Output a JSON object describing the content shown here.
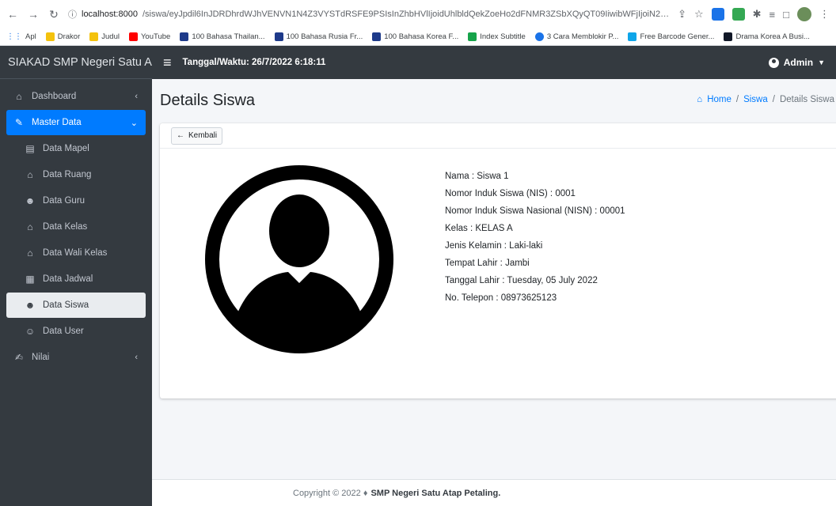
{
  "browser": {
    "url_host": "localhost:8000",
    "url_path": "/siswa/eyJpdil6InJDRDhrdWJhVENVN1N4Z3VYSTdRSFE9PSIsInZhbHVlIjoidUhlbldQekZoeHo2dFNMR3ZSbXQyQT09IiwibWFjIjoiN2M2NjcwNmI5Z...",
    "bookmarks": [
      "Apl",
      "Drakor",
      "Judul",
      "YouTube",
      "100 Bahasa Thailan...",
      "100 Bahasa Rusia Fr...",
      "100 Bahasa Korea F...",
      "Index Subtitle",
      "3 Cara Memblokir P...",
      "Free Barcode Gener...",
      "Drama Korea A Busi..."
    ]
  },
  "app": {
    "brand": "SIAKAD SMP Negeri Satu Atap",
    "datetime": "Tanggal/Waktu: 26/7/2022 6:18:11",
    "user": "Admin"
  },
  "sidebar": {
    "items": [
      {
        "label": "Dashboard"
      },
      {
        "label": "Master Data"
      },
      {
        "label": "Data Mapel"
      },
      {
        "label": "Data Ruang"
      },
      {
        "label": "Data Guru"
      },
      {
        "label": "Data Kelas"
      },
      {
        "label": "Data Wali Kelas"
      },
      {
        "label": "Data Jadwal"
      },
      {
        "label": "Data Siswa"
      },
      {
        "label": "Data User"
      },
      {
        "label": "Nilai"
      }
    ]
  },
  "page": {
    "title": "Details Siswa",
    "breadcrumb": [
      "Home",
      "Siswa",
      "Details Siswa"
    ],
    "back_label": "Kembali"
  },
  "student": {
    "nama": "Nama : Siswa 1",
    "nis": "Nomor Induk Siswa (NIS) : 0001",
    "nisn": "Nomor Induk Siswa Nasional (NISN) : 00001",
    "kelas": "Kelas : KELAS A",
    "jenis_kelamin": "Jenis Kelamin : Laki-laki",
    "tempat_lahir": "Tempat Lahir : Jambi",
    "tanggal_lahir": "Tanggal Lahir : Tuesday, 05 July 2022",
    "telepon": "No. Telepon : 08973625123"
  },
  "footer": {
    "copyright": "Copyright © 2022 ♦",
    "school": "SMP Negeri Satu Atap Petaling."
  },
  "colors": {
    "sidebar_bg": "#343a40",
    "primary": "#007bff",
    "content_bg": "#f4f6f9"
  }
}
